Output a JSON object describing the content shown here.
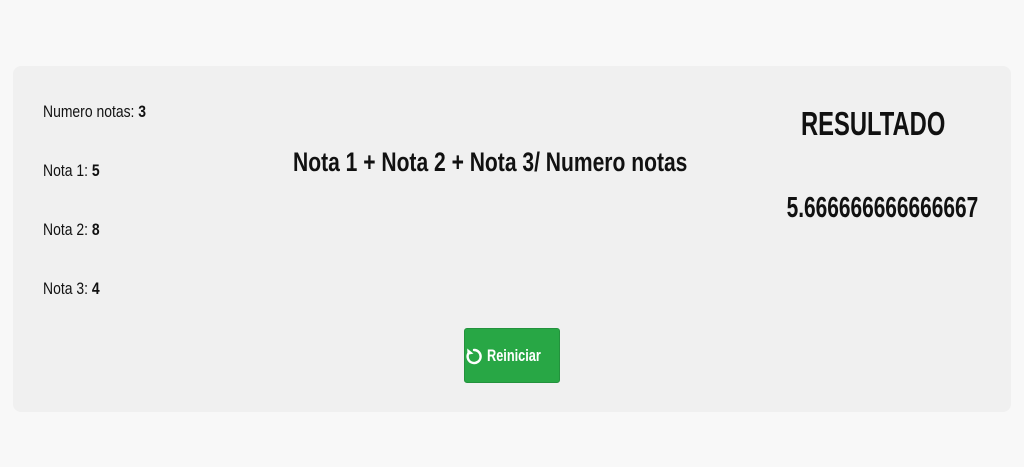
{
  "inputs": {
    "numero_notas_label": "Numero notas:",
    "numero_notas_value": "3",
    "nota1_label": "Nota 1:",
    "nota1_value": "5",
    "nota2_label": "Nota 2:",
    "nota2_value": "8",
    "nota3_label": "Nota 3:",
    "nota3_value": "4"
  },
  "formula": "Nota 1 + Nota 2 + Nota 3/ Numero notas",
  "result": {
    "title": "RESULTADO",
    "value": "5.666666666666667"
  },
  "actions": {
    "restart_label": "Reiniciar",
    "restart_icon": "refresh-icon",
    "restart_color": "#28a745"
  }
}
